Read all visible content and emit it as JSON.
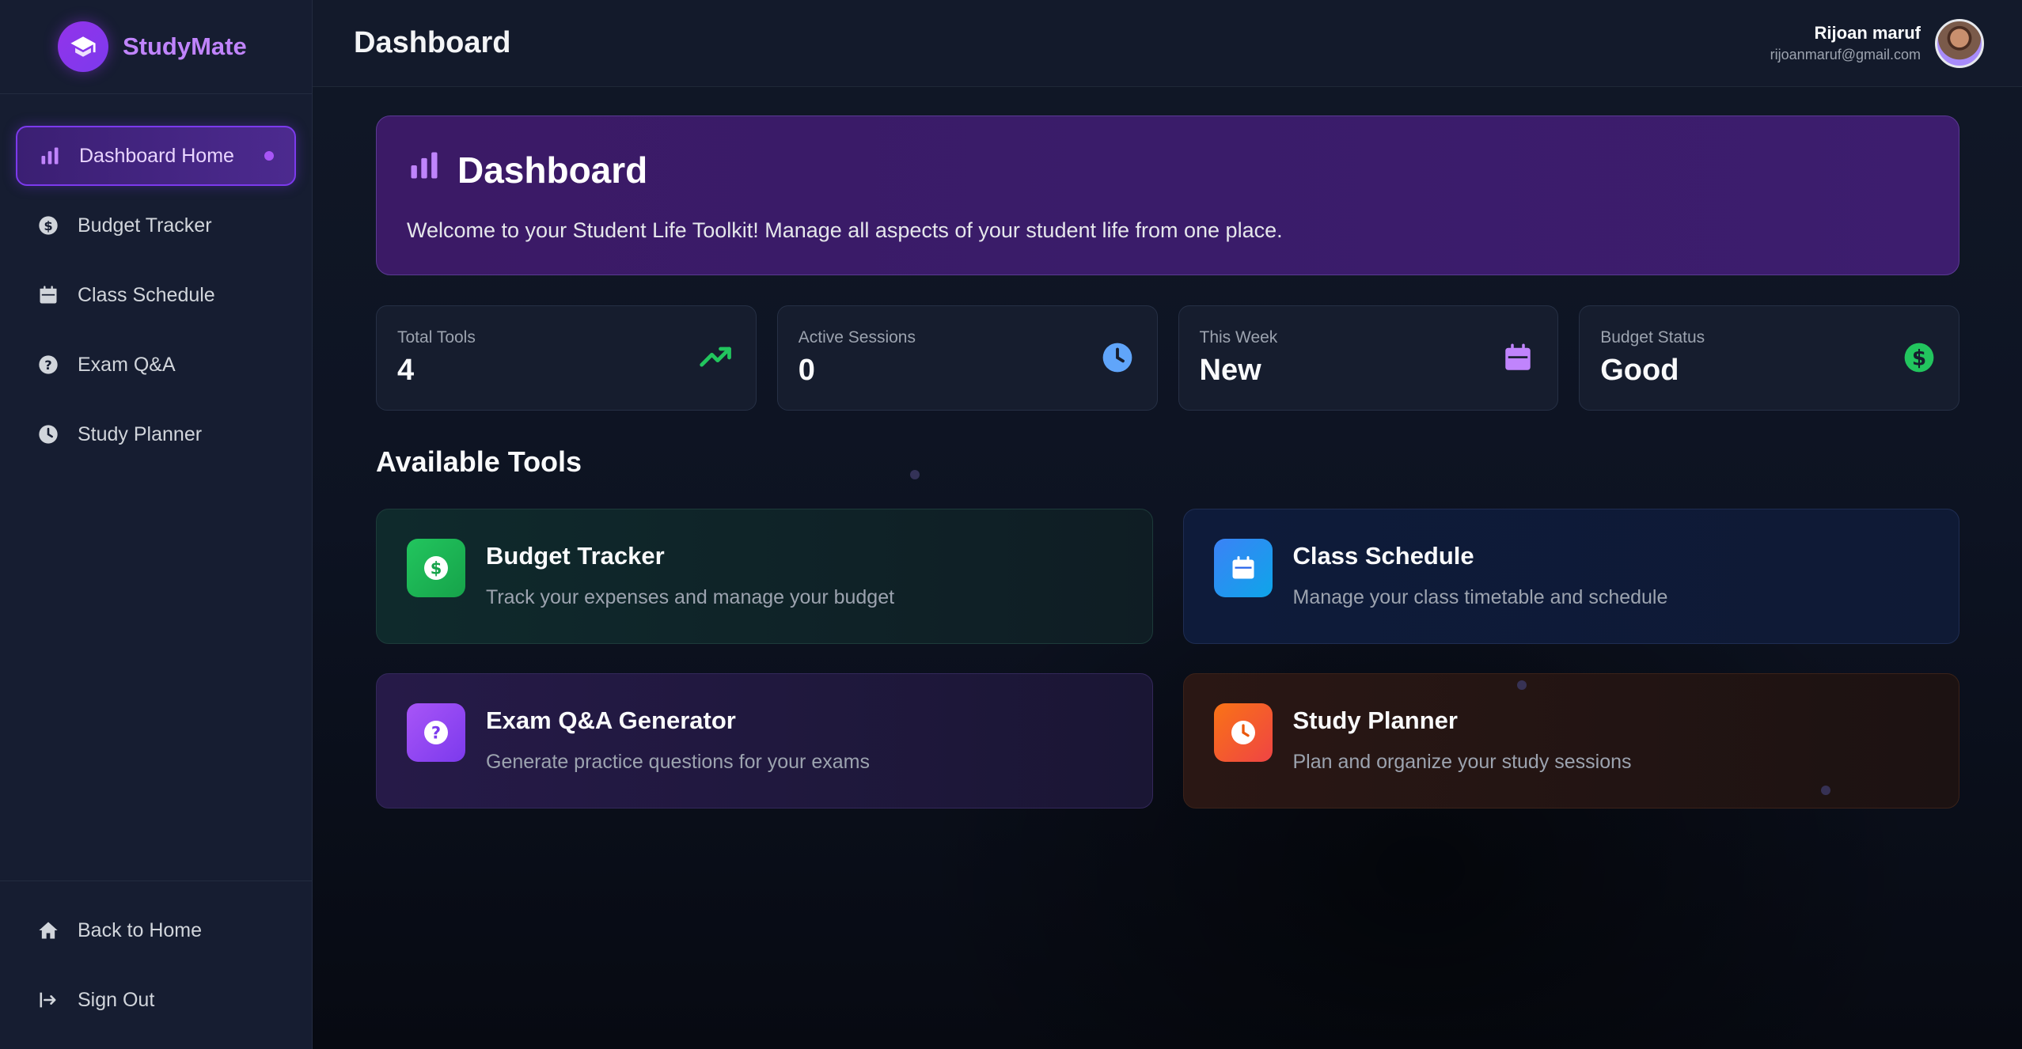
{
  "brand": {
    "name": "StudyMate",
    "icon": "graduation-cap-icon"
  },
  "sidebar": {
    "items": [
      {
        "label": "Dashboard Home",
        "icon": "bar-chart-icon",
        "active": true
      },
      {
        "label": "Budget Tracker",
        "icon": "dollar-circle-icon"
      },
      {
        "label": "Class Schedule",
        "icon": "calendar-icon"
      },
      {
        "label": "Exam Q&A",
        "icon": "question-circle-icon"
      },
      {
        "label": "Study Planner",
        "icon": "clock-icon"
      }
    ],
    "bottom": [
      {
        "label": "Back to Home",
        "icon": "home-icon"
      },
      {
        "label": "Sign Out",
        "icon": "sign-out-icon"
      }
    ]
  },
  "header": {
    "title": "Dashboard",
    "user": {
      "name": "Rijoan maruf",
      "email": "rijoanmaruf@gmail.com"
    }
  },
  "hero": {
    "title": "Dashboard",
    "subtitle": "Welcome to your Student Life Toolkit! Manage all aspects of your student life from one place."
  },
  "stats": [
    {
      "label": "Total Tools",
      "value": "4",
      "icon": "trending-up-icon",
      "color": "#22c55e"
    },
    {
      "label": "Active Sessions",
      "value": "0",
      "icon": "clock-icon",
      "color": "#60a5fa"
    },
    {
      "label": "This Week",
      "value": "New",
      "icon": "calendar-icon",
      "color": "#c084fc"
    },
    {
      "label": "Budget Status",
      "value": "Good",
      "icon": "dollar-circle-icon",
      "color": "#22c55e"
    }
  ],
  "tools_section": {
    "title": "Available Tools"
  },
  "tools": [
    {
      "title": "Budget Tracker",
      "desc": "Track your expenses and manage your budget",
      "icon": "dollar-circle-icon"
    },
    {
      "title": "Class Schedule",
      "desc": "Manage your class timetable and schedule",
      "icon": "calendar-icon"
    },
    {
      "title": "Exam Q&A Generator",
      "desc": "Generate practice questions for your exams",
      "icon": "question-circle-icon"
    },
    {
      "title": "Study Planner",
      "desc": "Plan and organize your study sessions",
      "icon": "clock-icon"
    }
  ],
  "colors": {
    "accent": "#a855f7",
    "sidebar_bg": "#161d31",
    "main_bg": "#0b1120"
  }
}
